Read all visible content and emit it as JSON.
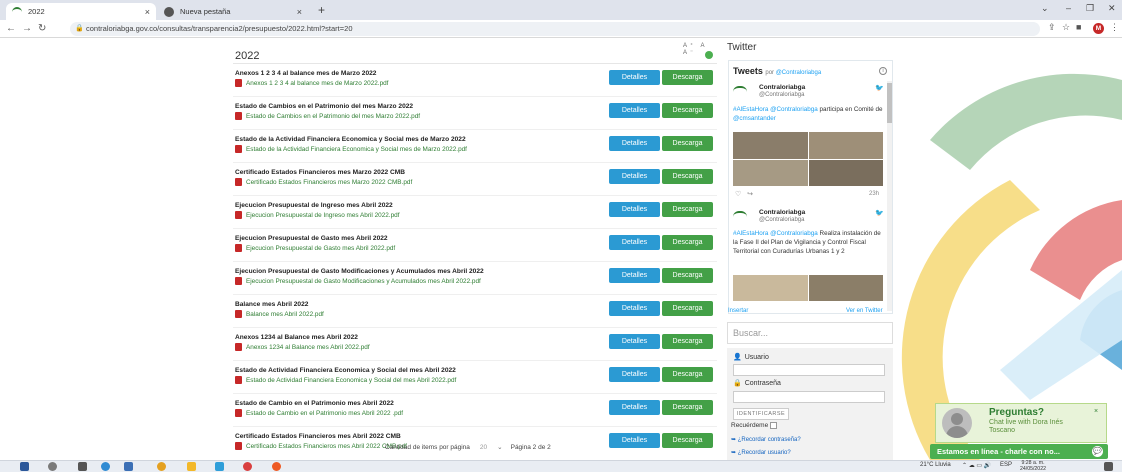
{
  "browser": {
    "tabs": [
      {
        "title": "2022",
        "close": "×"
      },
      {
        "title": "Nueva pestaña",
        "close": "×"
      }
    ],
    "new_tab": "+",
    "url": "contraloriabga.gov.co/consultas/transparencia2/presupuesto/2022.html?start=20",
    "avatar_letter": "M"
  },
  "page": {
    "font_controls": "A⁺ A A⁻",
    "year": "2022",
    "details_label": "Detalles",
    "download_label": "Descarga",
    "items": [
      {
        "title": "Anexos 1 2 3 4 al balance mes de Marzo 2022",
        "file": "Anexos 1 2 3 4 al balance mes de Marzo 2022.pdf"
      },
      {
        "title": "Estado de Cambios en el Patrimonio del mes Marzo 2022",
        "file": "Estado de Cambios en el Patrimonio del mes Marzo 2022.pdf"
      },
      {
        "title": "Estado de la Actividad Financiera Economica y Social mes de Marzo 2022",
        "file": "Estado de la Actividad Financiera Economica y Social mes de Marzo 2022.pdf"
      },
      {
        "title": "Certificado Estados Financieros mes Marzo 2022 CMB",
        "file": "Certificado Estados Financieros mes Marzo 2022 CMB.pdf"
      },
      {
        "title": "Ejecucion Presupuestal de Ingreso mes Abril 2022",
        "file": "Ejecucion Presupuestal de Ingreso mes Abril 2022.pdf"
      },
      {
        "title": "Ejecucion Presupuestal de Gasto mes Abril 2022",
        "file": "Ejecucion Presupuestal de Gasto mes Abril 2022.pdf"
      },
      {
        "title": "Ejecucion Presupuestal de Gasto Modificaciones y Acumulados mes Abril 2022",
        "file": "Ejecucion Presupuestal de Gasto Modificaciones y Acumulados mes Abril 2022.pdf"
      },
      {
        "title": "Balance mes Abril 2022",
        "file": "Balance mes Abril 2022.pdf"
      },
      {
        "title": "Anexos 1234 al Balance mes Abril 2022",
        "file": "Anexos 1234 al Balance mes Abril 2022.pdf"
      },
      {
        "title": "Estado de Actividad Financiera Economica y Social del mes Abril 2022",
        "file": "Estado de Actividad Financiera Economica y Social del mes Abril 2022.pdf"
      },
      {
        "title": "Estado de Cambio en el Patrimonio mes Abril 2022",
        "file": "Estado de Cambio en el Patrimonio mes Abril 2022 .pdf"
      },
      {
        "title": "Certificado Estados Financieros mes Abril 2022 CMB",
        "file": "Certificado Estados Financieros mes Abril 2022 CMB.pdf"
      }
    ],
    "pager": {
      "items_label": "Cantidad de items por página",
      "items_value": "20",
      "page_label": "Página 2 de 2"
    }
  },
  "twitter": {
    "header": "Twitter",
    "box_title": "Tweets",
    "by": "por",
    "by_handle": "@Contraloriabga",
    "tweet1": {
      "name": "Contraloriabga",
      "handle": "@Contraloriabga",
      "text_pre": "#AlEstaHora @Contraloriabga",
      "text_post": " participa en Comité de ",
      "mention": "@cmsantander",
      "time": "23h"
    },
    "tweet2": {
      "name": "Contraloriabga",
      "handle": "@Contraloriabga",
      "text_pre": "#AlEstaHora @Contraloriabga",
      "text_post": " Realiza instalación de la Fase II del Plan de Vigilancia y Control Fiscal Territorial con Curadurías Urbanas 1 y 2"
    },
    "embed": "Insertar",
    "view": "Ver en Twitter"
  },
  "sidebar": {
    "search_placeholder": "Buscar...",
    "user_label": "Usuario",
    "password_label": "Contraseña",
    "login_button": "IDENTIFICARSE",
    "remember": "Recuérdeme",
    "forgot_password": "¿Recordar contraseña?",
    "forgot_user": "¿Recordar usuario?"
  },
  "chat": {
    "title": "Preguntas?",
    "subtitle": "Chat live with Dora Inés Toscano",
    "bar": "Estamos en línea - charle con no..."
  },
  "taskbar": {
    "weather": "21°C Lluvia",
    "lang": "ESP",
    "time": "9:28 a. m.",
    "date": "24/05/2022"
  },
  "colors": {
    "details_btn": "#2b9ad3",
    "download_btn": "#43a047",
    "file_link": "#2e7d32",
    "chat_green": "#4caf50"
  }
}
